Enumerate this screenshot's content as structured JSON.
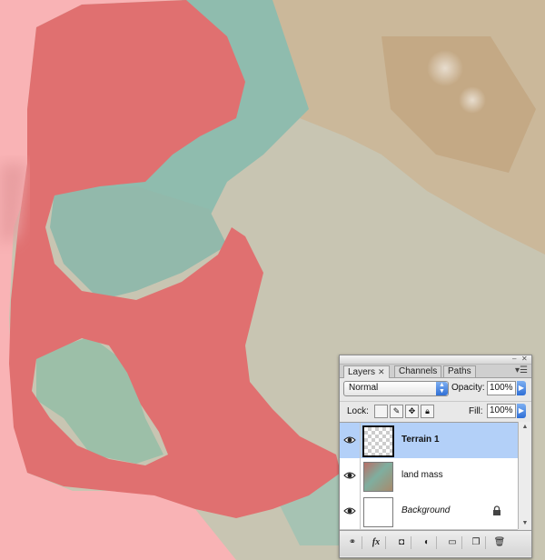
{
  "panel": {
    "tabs": [
      {
        "label": "Layers",
        "active": true,
        "close": "✕"
      },
      {
        "label": "Channels",
        "active": false
      },
      {
        "label": "Paths",
        "active": false
      }
    ],
    "blend_mode": "Normal",
    "opacity_label": "Opacity:",
    "opacity_value": "100%",
    "lock_label": "Lock:",
    "fill_label": "Fill:",
    "fill_value": "100%",
    "layers": [
      {
        "name": "Terrain 1",
        "selected": true,
        "visible": true,
        "thumb": "checker"
      },
      {
        "name": "land mass",
        "selected": false,
        "visible": true,
        "thumb": "land"
      },
      {
        "name": "Background",
        "selected": false,
        "visible": true,
        "thumb": "white",
        "locked": true
      }
    ],
    "bottom_buttons": {
      "fx": "fx"
    }
  },
  "colors": {
    "canvas_background": "#f9b3b5",
    "mask_red": "#e07070",
    "selection_blue": "#b3d0f8",
    "accent_blue": "#2f6fd6"
  },
  "icons": [
    "eye-icon",
    "lock-icon",
    "link-icon",
    "fx-icon",
    "mask-icon",
    "adjustment-icon",
    "folder-icon",
    "new-layer-icon",
    "trash-icon",
    "panel-menu-icon"
  ]
}
